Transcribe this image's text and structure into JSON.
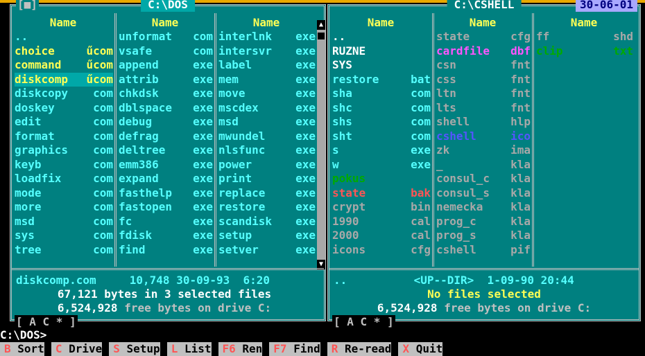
{
  "colors": {
    "panel": "#008080",
    "active_title": "#00a8a8",
    "header": "#ffff55",
    "file": "#55ffff",
    "white": "#ffffff",
    "grey": "#a8a8a8",
    "magenta": "#ff55ff",
    "green": "#00aa00",
    "red": "#ff5555",
    "blue": "#5555ff"
  },
  "left": {
    "marker": "[■]",
    "title": "C:\\DOS",
    "headers": [
      "Name",
      "Name",
      "Name"
    ],
    "columns": [
      [
        {
          "n": "..",
          "e": "",
          "c": "#55ffff"
        },
        {
          "n": "choice",
          "e": "űcom",
          "c": "#ffff55"
        },
        {
          "n": "command",
          "e": "űcom",
          "c": "#ffff55"
        },
        {
          "n": "diskcomp",
          "e": "űcom",
          "c": "#ffff55",
          "sel": true
        },
        {
          "n": "diskcopy",
          "e": "com",
          "c": "#55ffff"
        },
        {
          "n": "doskey",
          "e": "com",
          "c": "#55ffff"
        },
        {
          "n": "edit",
          "e": "com",
          "c": "#55ffff"
        },
        {
          "n": "format",
          "e": "com",
          "c": "#55ffff"
        },
        {
          "n": "graphics",
          "e": "com",
          "c": "#55ffff"
        },
        {
          "n": "keyb",
          "e": "com",
          "c": "#55ffff"
        },
        {
          "n": "loadfix",
          "e": "com",
          "c": "#55ffff"
        },
        {
          "n": "mode",
          "e": "com",
          "c": "#55ffff"
        },
        {
          "n": "more",
          "e": "com",
          "c": "#55ffff"
        },
        {
          "n": "msd",
          "e": "com",
          "c": "#55ffff"
        },
        {
          "n": "sys",
          "e": "com",
          "c": "#55ffff"
        },
        {
          "n": "tree",
          "e": "com",
          "c": "#55ffff"
        }
      ],
      [
        {
          "n": "unformat",
          "e": "com",
          "c": "#55ffff"
        },
        {
          "n": "vsafe",
          "e": "com",
          "c": "#55ffff"
        },
        {
          "n": "append",
          "e": "exe",
          "c": "#55ffff"
        },
        {
          "n": "attrib",
          "e": "exe",
          "c": "#55ffff"
        },
        {
          "n": "chkdsk",
          "e": "exe",
          "c": "#55ffff"
        },
        {
          "n": "dblspace",
          "e": "exe",
          "c": "#55ffff"
        },
        {
          "n": "debug",
          "e": "exe",
          "c": "#55ffff"
        },
        {
          "n": "defrag",
          "e": "exe",
          "c": "#55ffff"
        },
        {
          "n": "deltree",
          "e": "exe",
          "c": "#55ffff"
        },
        {
          "n": "emm386",
          "e": "exe",
          "c": "#55ffff"
        },
        {
          "n": "expand",
          "e": "exe",
          "c": "#55ffff"
        },
        {
          "n": "fasthelp",
          "e": "exe",
          "c": "#55ffff"
        },
        {
          "n": "fastopen",
          "e": "exe",
          "c": "#55ffff"
        },
        {
          "n": "fc",
          "e": "exe",
          "c": "#55ffff"
        },
        {
          "n": "fdisk",
          "e": "exe",
          "c": "#55ffff"
        },
        {
          "n": "find",
          "e": "exe",
          "c": "#55ffff"
        }
      ],
      [
        {
          "n": "interlnk",
          "e": "exe",
          "c": "#55ffff"
        },
        {
          "n": "intersvr",
          "e": "exe",
          "c": "#55ffff"
        },
        {
          "n": "label",
          "e": "exe",
          "c": "#55ffff"
        },
        {
          "n": "mem",
          "e": "exe",
          "c": "#55ffff"
        },
        {
          "n": "move",
          "e": "exe",
          "c": "#55ffff"
        },
        {
          "n": "mscdex",
          "e": "exe",
          "c": "#55ffff"
        },
        {
          "n": "msd",
          "e": "exe",
          "c": "#55ffff"
        },
        {
          "n": "mwundel",
          "e": "exe",
          "c": "#55ffff"
        },
        {
          "n": "nlsfunc",
          "e": "exe",
          "c": "#55ffff"
        },
        {
          "n": "power",
          "e": "exe",
          "c": "#55ffff"
        },
        {
          "n": "print",
          "e": "exe",
          "c": "#55ffff"
        },
        {
          "n": "replace",
          "e": "exe",
          "c": "#55ffff"
        },
        {
          "n": "restore",
          "e": "exe",
          "c": "#55ffff"
        },
        {
          "n": "scandisk",
          "e": "exe",
          "c": "#55ffff"
        },
        {
          "n": "setup",
          "e": "exe",
          "c": "#55ffff"
        },
        {
          "n": "setver",
          "e": "exe",
          "c": "#55ffff"
        }
      ]
    ],
    "info_line1": "diskcomp.com     10,748 30-09-93  6:20",
    "info_line2": "67,121 bytes in 3 selected files",
    "info_free_num": "6,524,928",
    "info_free_text": " free bytes on drive C:",
    "drives": "[ A C * ]"
  },
  "right": {
    "title": "C:\\CSHELL",
    "date": "30-06-01",
    "headers": [
      "Name",
      "Name",
      "Name"
    ],
    "columns": [
      [
        {
          "n": "..",
          "e": "",
          "c": "#ffffff"
        },
        {
          "n": "RUZNE",
          "e": "",
          "c": "#ffffff"
        },
        {
          "n": "SYS",
          "e": "",
          "c": "#ffffff"
        },
        {
          "n": "restore",
          "e": "bat",
          "c": "#55ffff"
        },
        {
          "n": "sha",
          "e": "com",
          "c": "#55ffff"
        },
        {
          "n": "shc",
          "e": "com",
          "c": "#55ffff"
        },
        {
          "n": "shs",
          "e": "com",
          "c": "#55ffff"
        },
        {
          "n": "sht",
          "e": "com",
          "c": "#55ffff"
        },
        {
          "n": "s",
          "e": "exe",
          "c": "#55ffff"
        },
        {
          "n": "w",
          "e": "exe",
          "c": "#55ffff"
        },
        {
          "n": "pokus",
          "e": "",
          "c": "#00aa00"
        },
        {
          "n": "state",
          "e": "bak",
          "c": "#ff5555"
        },
        {
          "n": "crypt",
          "e": "bin",
          "c": "#a8a8a8"
        },
        {
          "n": "1990",
          "e": "cal",
          "c": "#a8a8a8"
        },
        {
          "n": "2000",
          "e": "cal",
          "c": "#a8a8a8"
        },
        {
          "n": "icons",
          "e": "cfg",
          "c": "#a8a8a8"
        }
      ],
      [
        {
          "n": "state",
          "e": "cfg",
          "c": "#a8a8a8"
        },
        {
          "n": "cardfile",
          "e": "dbf",
          "c": "#ff55ff"
        },
        {
          "n": "csn",
          "e": "fnt",
          "c": "#a8a8a8"
        },
        {
          "n": "css",
          "e": "fnt",
          "c": "#a8a8a8"
        },
        {
          "n": "ltn",
          "e": "fnt",
          "c": "#a8a8a8"
        },
        {
          "n": "lts",
          "e": "fnt",
          "c": "#a8a8a8"
        },
        {
          "n": "shell",
          "e": "hlp",
          "c": "#a8a8a8"
        },
        {
          "n": "cshell",
          "e": "ico",
          "c": "#5555ff"
        },
        {
          "n": "zk",
          "e": "ima",
          "c": "#a8a8a8"
        },
        {
          "n": "_",
          "e": "kla",
          "c": "#a8a8a8"
        },
        {
          "n": "consul_c",
          "e": "kla",
          "c": "#a8a8a8"
        },
        {
          "n": "consul_s",
          "e": "kla",
          "c": "#a8a8a8"
        },
        {
          "n": "nemecka",
          "e": "kla",
          "c": "#a8a8a8"
        },
        {
          "n": "prog_c",
          "e": "kla",
          "c": "#a8a8a8"
        },
        {
          "n": "prog_s",
          "e": "kla",
          "c": "#a8a8a8"
        },
        {
          "n": "cshell",
          "e": "pif",
          "c": "#a8a8a8"
        }
      ],
      [
        {
          "n": "ff",
          "e": "shd",
          "c": "#a8a8a8"
        },
        {
          "n": "clip",
          "e": "txt",
          "c": "#00aa00"
        }
      ]
    ],
    "info_line1": "..          <UP--DIR>  1-09-90 20:44",
    "info_line2": "No files selected",
    "info_free_num": "6,524,928",
    "info_free_text": " free bytes on drive C:",
    "drives": "[ A C * ]"
  },
  "prompt": "C:\\DOS>",
  "keybar": [
    {
      "key": "B",
      "label": "Sort"
    },
    {
      "key": "C",
      "label": "Drive"
    },
    {
      "key": "S",
      "label": "Setup"
    },
    {
      "key": "L",
      "label": "List"
    },
    {
      "key": "F6",
      "label": "Ren"
    },
    {
      "key": "F7",
      "label": "Find"
    },
    {
      "key": "R",
      "label": "Re-read"
    },
    {
      "key": "X",
      "label": "Quit"
    }
  ]
}
